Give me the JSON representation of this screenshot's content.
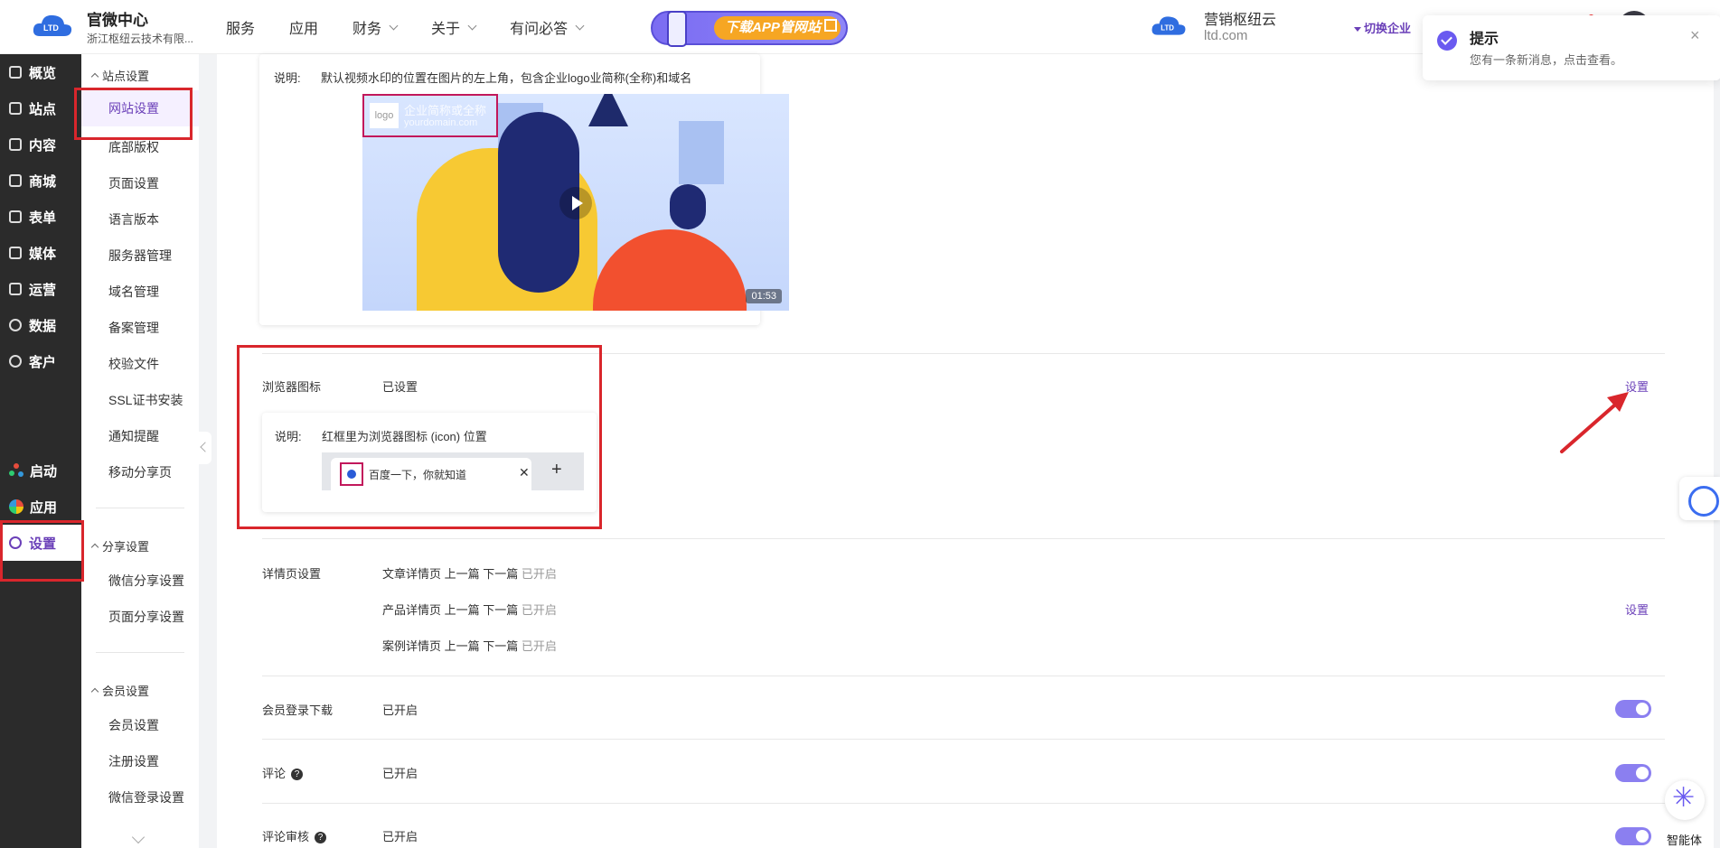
{
  "header": {
    "brand_title": "官微中心",
    "brand_sub": "浙江枢纽云技术有限...",
    "nav": [
      {
        "label": "服务",
        "dropdown": false
      },
      {
        "label": "应用",
        "dropdown": false
      },
      {
        "label": "财务",
        "dropdown": true
      },
      {
        "label": "关于",
        "dropdown": true
      },
      {
        "label": "有问必答",
        "dropdown": true
      }
    ],
    "app_banner": "下载APP管网站",
    "enterprise_name": "营销枢纽云",
    "enterprise_domain": "ltd.com",
    "switch_enterprise": "切换企业"
  },
  "left_nav": [
    {
      "label": "概览"
    },
    {
      "label": "站点"
    },
    {
      "label": "内容"
    },
    {
      "label": "商城"
    },
    {
      "label": "表单"
    },
    {
      "label": "媒体"
    },
    {
      "label": "运营"
    },
    {
      "label": "数据"
    },
    {
      "label": "客户"
    },
    {
      "label": "启动"
    },
    {
      "label": "应用"
    },
    {
      "label": "设置"
    }
  ],
  "sub_nav": {
    "group1": "站点设置",
    "group1_items": [
      "网站设置",
      "底部版权",
      "页面设置",
      "语言版本",
      "服务器管理",
      "域名管理",
      "备案管理",
      "校验文件",
      "SSL证书安装",
      "通知提醒",
      "移动分享页"
    ],
    "group2": "分享设置",
    "group2_items": [
      "微信分享设置",
      "页面分享设置"
    ],
    "group3": "会员设置",
    "group3_items": [
      "会员设置",
      "注册设置",
      "微信登录设置"
    ]
  },
  "watermark_card": {
    "label": "说明:",
    "text": "默认视频水印的位置在图片的左上角，包含企业logo业简称(全称)和域名",
    "logo": "logo",
    "name": "企业简称或全称",
    "domain": "yourdomain.com",
    "duration": "01:53"
  },
  "favicon_row": {
    "label": "浏览器图标",
    "value": "已设置",
    "action": "设置",
    "desc_label": "说明:",
    "desc_text": "红框里为浏览器图标 (icon) 位置",
    "tab_title": "百度一下，你就知道",
    "tab_close": "✕",
    "tab_plus": "+"
  },
  "detail_row": {
    "label": "详情页设置",
    "lines": [
      {
        "text": "文章详情页 上一篇 下一篇",
        "status": "已开启"
      },
      {
        "text": "产品详情页 上一篇 下一篇",
        "status": "已开启"
      },
      {
        "text": "案例详情页 上一篇 下一篇",
        "status": "已开启"
      }
    ],
    "action": "设置"
  },
  "member_row": {
    "label": "会员登录下载",
    "value": "已开启",
    "enabled": true
  },
  "comment_row": {
    "label": "评论",
    "help": "?",
    "value": "已开启",
    "enabled": true
  },
  "review_row": {
    "label": "评论审核",
    "help": "?",
    "value": "已开启",
    "enabled": true
  },
  "toast": {
    "title": "提示",
    "message": "您有一条新消息，点击查看。",
    "close": "×"
  },
  "agent_label": "智能体",
  "colors": {
    "accent": "#6a3fb8",
    "highlight": "#d9262c",
    "toggle": "#8b7ff0"
  }
}
